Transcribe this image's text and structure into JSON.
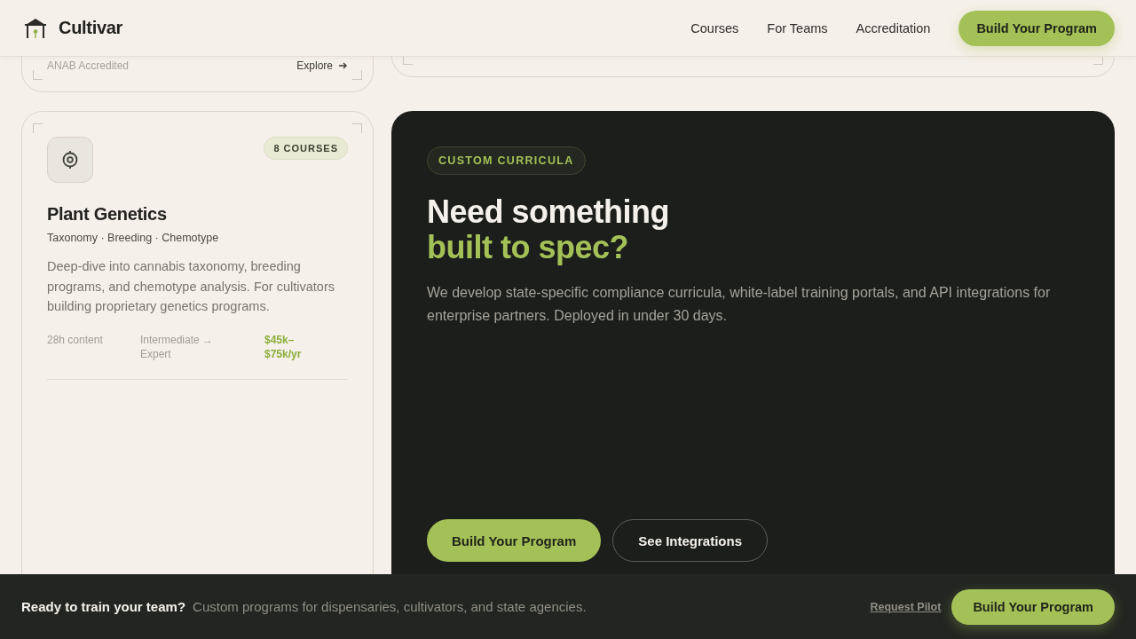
{
  "header": {
    "brand": "Cultivar",
    "nav": [
      {
        "label": "Courses"
      },
      {
        "label": "For Teams"
      },
      {
        "label": "Accreditation"
      }
    ],
    "cta": "Build Your Program"
  },
  "top_card": {
    "note": "ANAB Accredited",
    "link": "Explore"
  },
  "course_card": {
    "badge": "8 COURSES",
    "title": "Plant Genetics",
    "tags": "Taxonomy · Breeding · Chemotype",
    "description": "Deep-dive into cannabis taxonomy, breeding programs, and chemotype analysis. For cultivators building proprietary genetics programs.",
    "stats": [
      {
        "text": "28h content",
        "kind": "plain"
      },
      {
        "text": "Intermediate → Expert",
        "kind": "plain"
      },
      {
        "text": "$45k–$75k/yr",
        "kind": "salary"
      }
    ]
  },
  "custom_panel": {
    "badge": "CUSTOM CURRICULA",
    "heading": "Need something",
    "heading_accent": "built to spec?",
    "body": "We develop state-specific compliance curricula, white-label training portals, and API integrations for enterprise partners. Deployed in under 30 days.",
    "buttons": [
      {
        "label": "Build Your Program",
        "kind": "primary"
      },
      {
        "label": "See Integrations",
        "kind": "outline"
      }
    ]
  },
  "bottom_bar": {
    "title": "Ready to train your team?",
    "text": "Custom programs for dispensaries, cultivators, and state agencies.",
    "link": "Request Pilot",
    "cta": "Build Your Program"
  }
}
